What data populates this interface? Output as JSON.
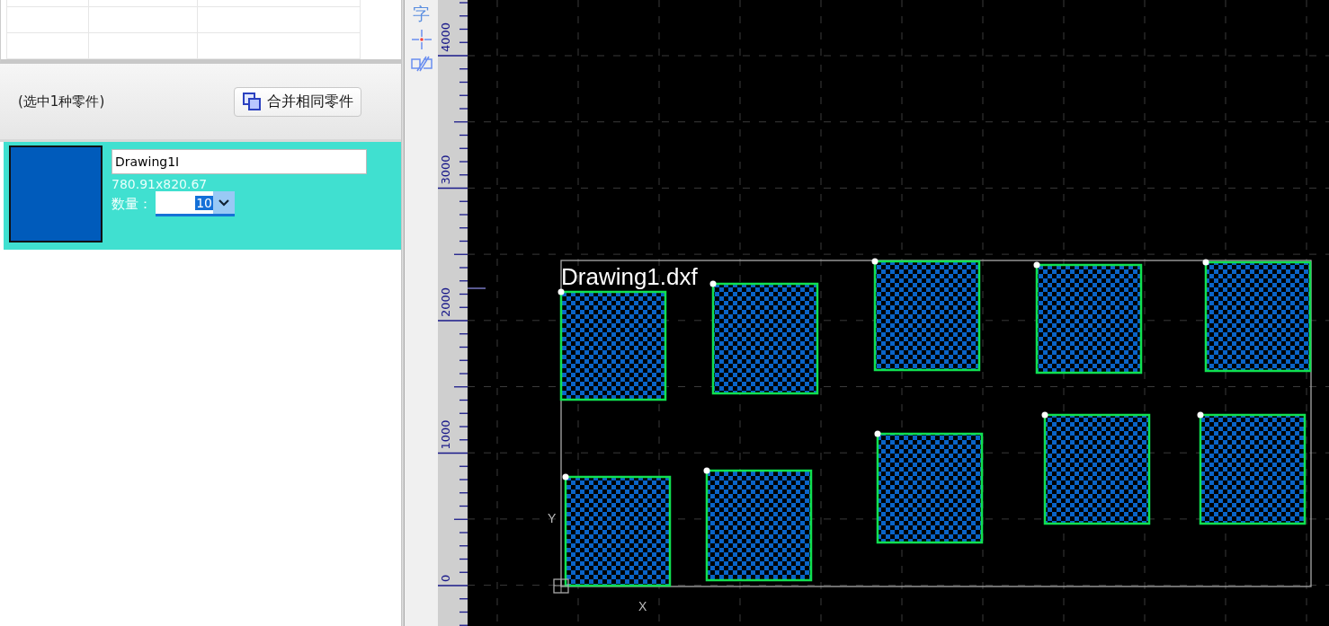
{
  "selection": {
    "summary": "(选中1种零件)",
    "merge_button": "合并相同零件"
  },
  "part_list": [
    {
      "name": "Drawing1I",
      "size": "780.91x820.67",
      "quantity_label": "数量：",
      "quantity": "10",
      "selected": true,
      "color": "#005bbb"
    }
  ],
  "toolbar": [
    {
      "kind": "glyph",
      "label": "字"
    },
    {
      "kind": "crosshair"
    },
    {
      "kind": "mirror"
    }
  ],
  "ruler": {
    "labels": [
      "0",
      "1000",
      "2000",
      "3000",
      "4000"
    ]
  },
  "canvas": {
    "title": "Drawing1.dxf",
    "axis_y": "Y",
    "axis_x": "X"
  }
}
